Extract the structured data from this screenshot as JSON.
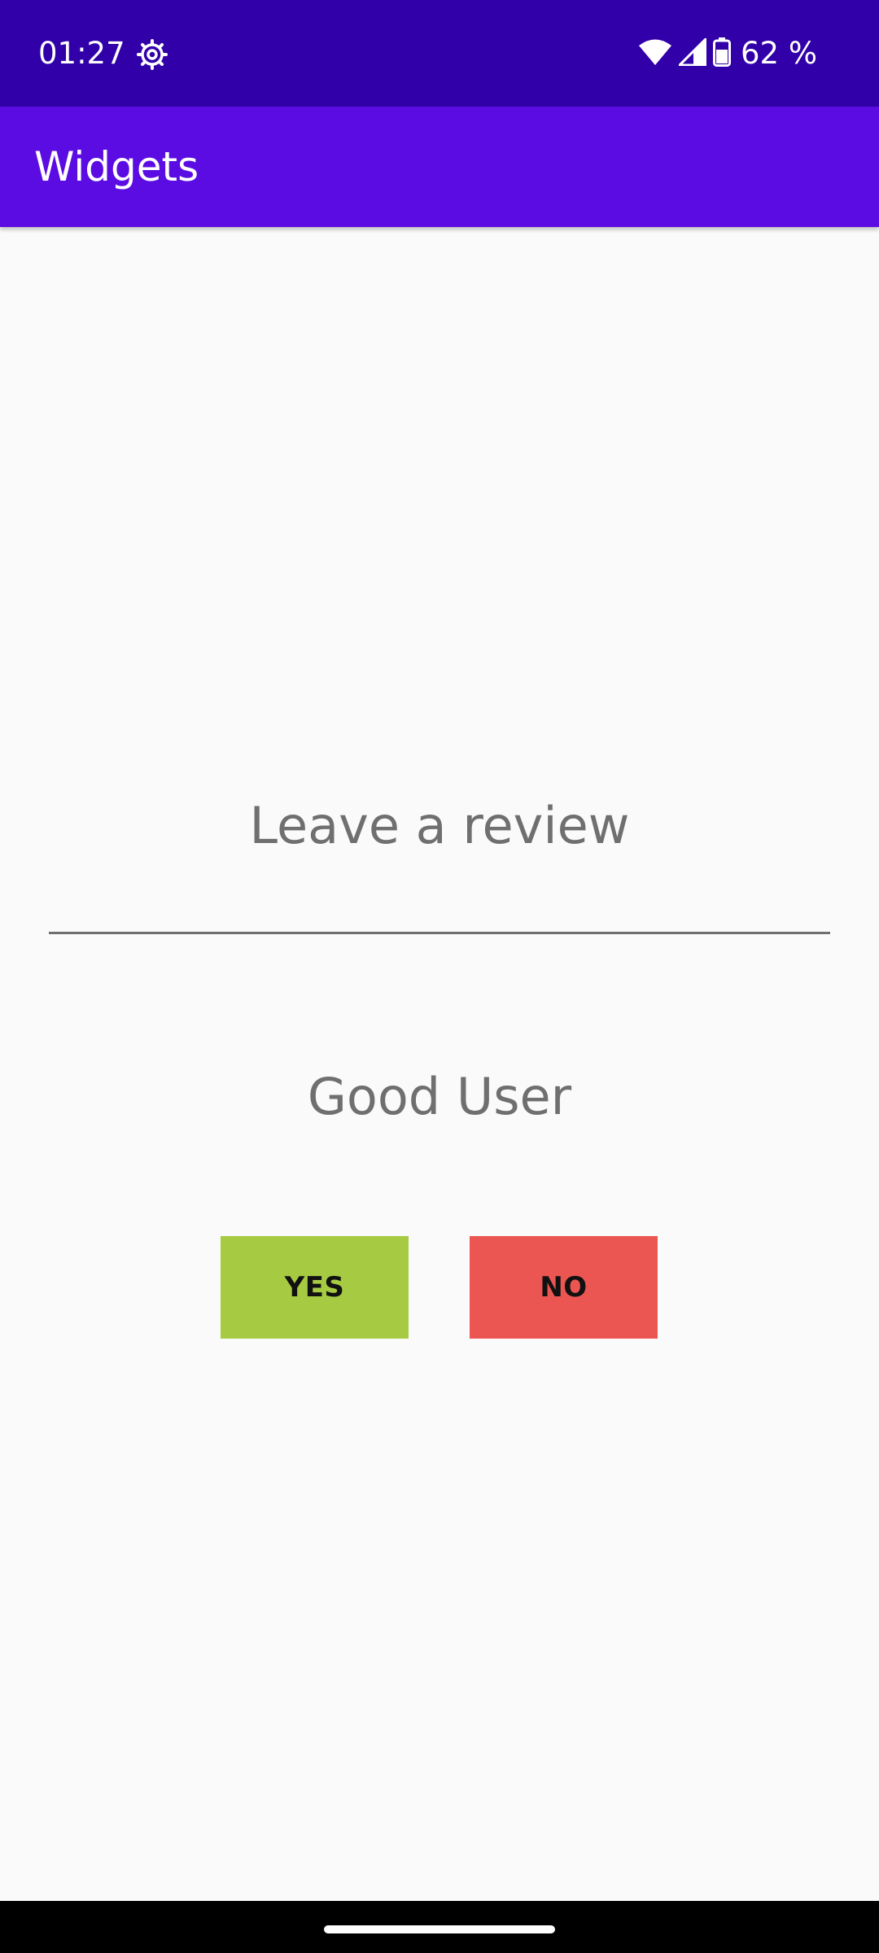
{
  "status_bar": {
    "time": "01:27",
    "battery_percent": "62 %",
    "icons": [
      "settings-gear-icon",
      "wifi-icon",
      "cell-signal-icon",
      "battery-icon"
    ],
    "background": "#3100a8"
  },
  "app_bar": {
    "title": "Widgets",
    "background": "#5b0ce3"
  },
  "main": {
    "heading": "Leave a review",
    "review_input": {
      "value": "",
      "placeholder": ""
    },
    "result_text": "Good User",
    "buttons": {
      "yes_label": "YES",
      "yes_color": "#a6cb43",
      "no_label": "NO",
      "no_color": "#ec5652"
    }
  }
}
